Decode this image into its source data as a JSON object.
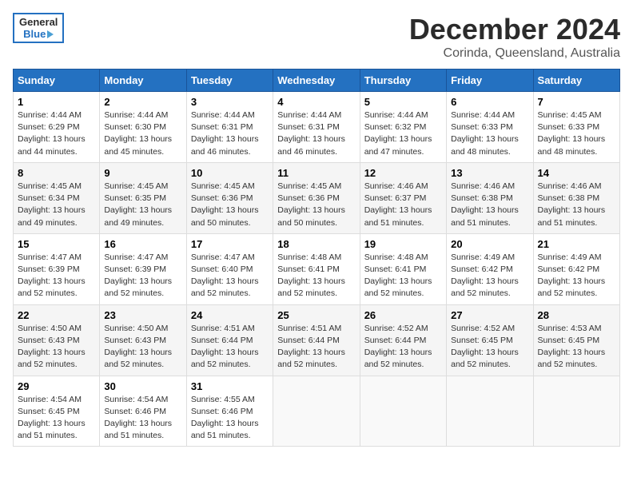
{
  "header": {
    "logo_general": "General",
    "logo_blue": "Blue",
    "month": "December 2024",
    "location": "Corinda, Queensland, Australia"
  },
  "weekdays": [
    "Sunday",
    "Monday",
    "Tuesday",
    "Wednesday",
    "Thursday",
    "Friday",
    "Saturday"
  ],
  "weeks": [
    [
      {
        "num": "1",
        "rise": "4:44 AM",
        "set": "6:29 PM",
        "hours": "13",
        "mins": "44"
      },
      {
        "num": "2",
        "rise": "4:44 AM",
        "set": "6:30 PM",
        "hours": "13",
        "mins": "45"
      },
      {
        "num": "3",
        "rise": "4:44 AM",
        "set": "6:31 PM",
        "hours": "13",
        "mins": "46"
      },
      {
        "num": "4",
        "rise": "4:44 AM",
        "set": "6:31 PM",
        "hours": "13",
        "mins": "46"
      },
      {
        "num": "5",
        "rise": "4:44 AM",
        "set": "6:32 PM",
        "hours": "13",
        "mins": "47"
      },
      {
        "num": "6",
        "rise": "4:44 AM",
        "set": "6:33 PM",
        "hours": "13",
        "mins": "48"
      },
      {
        "num": "7",
        "rise": "4:45 AM",
        "set": "6:33 PM",
        "hours": "13",
        "mins": "48"
      }
    ],
    [
      {
        "num": "8",
        "rise": "4:45 AM",
        "set": "6:34 PM",
        "hours": "13",
        "mins": "49"
      },
      {
        "num": "9",
        "rise": "4:45 AM",
        "set": "6:35 PM",
        "hours": "13",
        "mins": "49"
      },
      {
        "num": "10",
        "rise": "4:45 AM",
        "set": "6:36 PM",
        "hours": "13",
        "mins": "50"
      },
      {
        "num": "11",
        "rise": "4:45 AM",
        "set": "6:36 PM",
        "hours": "13",
        "mins": "50"
      },
      {
        "num": "12",
        "rise": "4:46 AM",
        "set": "6:37 PM",
        "hours": "13",
        "mins": "51"
      },
      {
        "num": "13",
        "rise": "4:46 AM",
        "set": "6:38 PM",
        "hours": "13",
        "mins": "51"
      },
      {
        "num": "14",
        "rise": "4:46 AM",
        "set": "6:38 PM",
        "hours": "13",
        "mins": "51"
      }
    ],
    [
      {
        "num": "15",
        "rise": "4:47 AM",
        "set": "6:39 PM",
        "hours": "13",
        "mins": "52"
      },
      {
        "num": "16",
        "rise": "4:47 AM",
        "set": "6:39 PM",
        "hours": "13",
        "mins": "52"
      },
      {
        "num": "17",
        "rise": "4:47 AM",
        "set": "6:40 PM",
        "hours": "13",
        "mins": "52"
      },
      {
        "num": "18",
        "rise": "4:48 AM",
        "set": "6:41 PM",
        "hours": "13",
        "mins": "52"
      },
      {
        "num": "19",
        "rise": "4:48 AM",
        "set": "6:41 PM",
        "hours": "13",
        "mins": "52"
      },
      {
        "num": "20",
        "rise": "4:49 AM",
        "set": "6:42 PM",
        "hours": "13",
        "mins": "52"
      },
      {
        "num": "21",
        "rise": "4:49 AM",
        "set": "6:42 PM",
        "hours": "13",
        "mins": "52"
      }
    ],
    [
      {
        "num": "22",
        "rise": "4:50 AM",
        "set": "6:43 PM",
        "hours": "13",
        "mins": "52"
      },
      {
        "num": "23",
        "rise": "4:50 AM",
        "set": "6:43 PM",
        "hours": "13",
        "mins": "52"
      },
      {
        "num": "24",
        "rise": "4:51 AM",
        "set": "6:44 PM",
        "hours": "13",
        "mins": "52"
      },
      {
        "num": "25",
        "rise": "4:51 AM",
        "set": "6:44 PM",
        "hours": "13",
        "mins": "52"
      },
      {
        "num": "26",
        "rise": "4:52 AM",
        "set": "6:44 PM",
        "hours": "13",
        "mins": "52"
      },
      {
        "num": "27",
        "rise": "4:52 AM",
        "set": "6:45 PM",
        "hours": "13",
        "mins": "52"
      },
      {
        "num": "28",
        "rise": "4:53 AM",
        "set": "6:45 PM",
        "hours": "13",
        "mins": "52"
      }
    ],
    [
      {
        "num": "29",
        "rise": "4:54 AM",
        "set": "6:45 PM",
        "hours": "13",
        "mins": "51"
      },
      {
        "num": "30",
        "rise": "4:54 AM",
        "set": "6:46 PM",
        "hours": "13",
        "mins": "51"
      },
      {
        "num": "31",
        "rise": "4:55 AM",
        "set": "6:46 PM",
        "hours": "13",
        "mins": "51"
      },
      null,
      null,
      null,
      null
    ]
  ],
  "labels": {
    "sunrise": "Sunrise:",
    "sunset": "Sunset:",
    "daylight": "Daylight: 13 hours"
  }
}
